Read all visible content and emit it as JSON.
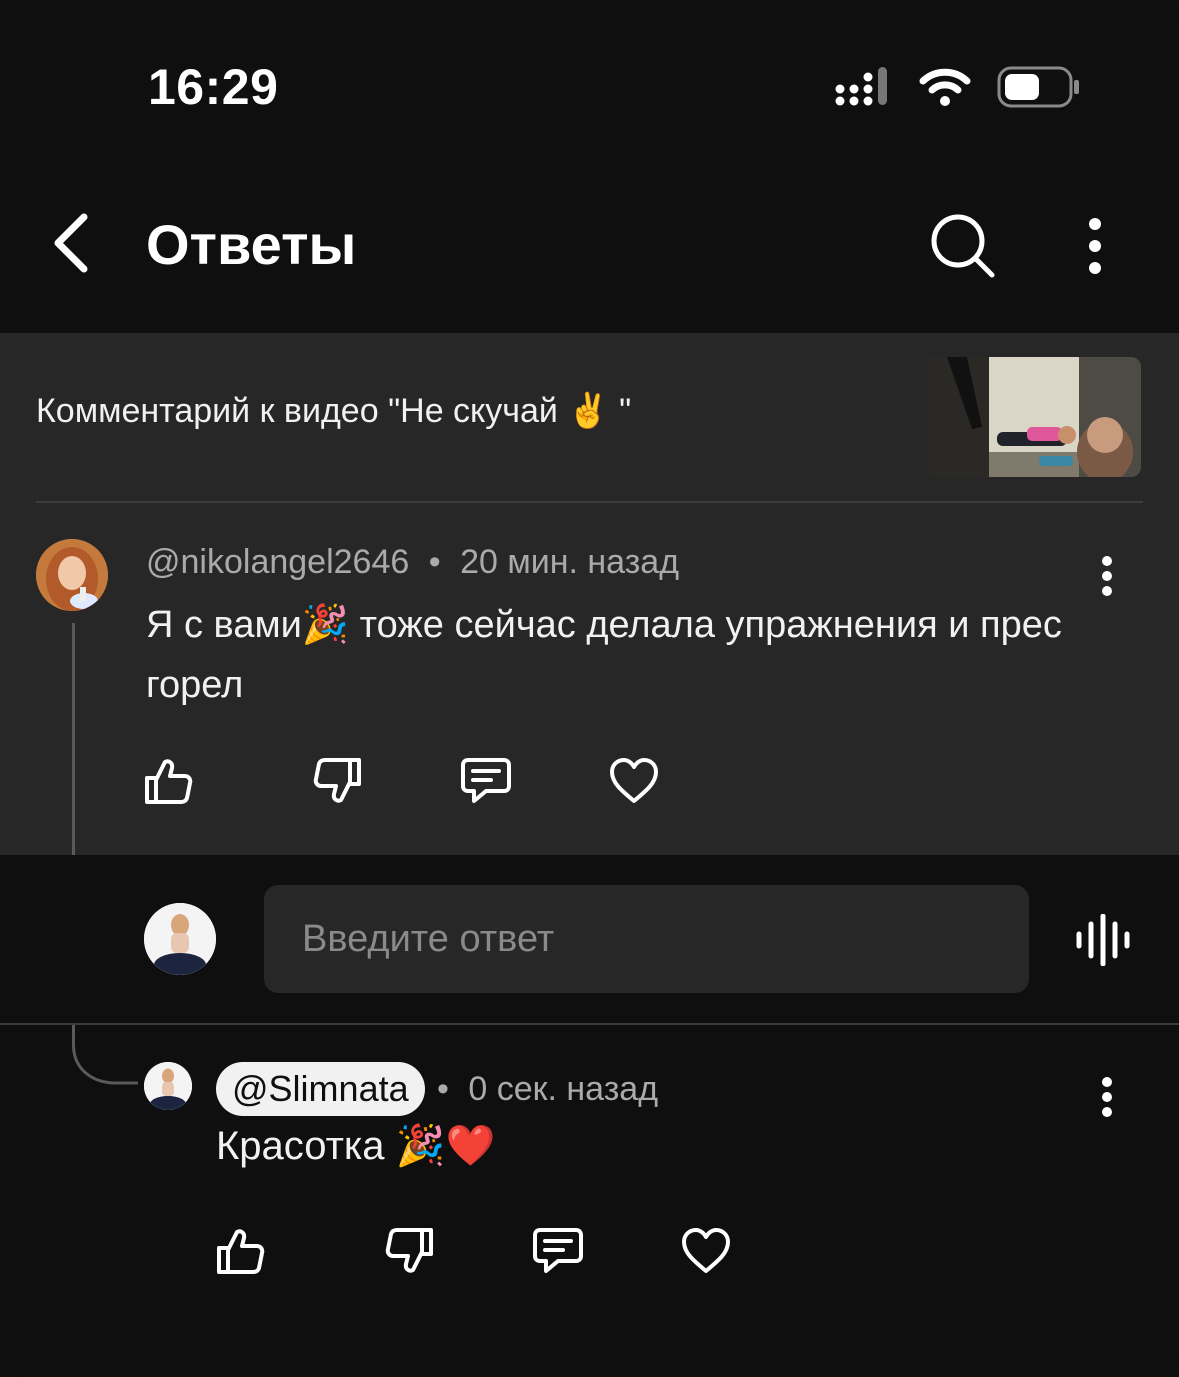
{
  "status_bar": {
    "time": "16:29",
    "icons": [
      "signal-icon",
      "wifi-icon",
      "battery-icon"
    ]
  },
  "header": {
    "title": "Ответы",
    "icons": [
      "back-arrow-icon",
      "search-icon",
      "more-vert-icon"
    ]
  },
  "video": {
    "caption": "Комментарий к видео \"Не скучай ✌️ \""
  },
  "parent_comment": {
    "author": "@nikolangel2646",
    "separator": "•",
    "time": "20 мин. назад",
    "text": "Я с вами🎉 тоже сейчас делала упражнения и прес горел",
    "actions": [
      "like-icon",
      "dislike-icon",
      "reply-icon",
      "heart-icon"
    ]
  },
  "reply_box": {
    "placeholder": "Введите ответ",
    "voice_icon": "voice-search-icon"
  },
  "reply_comment": {
    "author": "@Slimnata",
    "separator": "•",
    "time": "0 сек. назад",
    "text": "Красотка 🎉❤️",
    "actions": [
      "like-icon",
      "dislike-icon",
      "reply-icon",
      "heart-icon"
    ]
  },
  "colors": {
    "background": "#0f0f0f",
    "panel": "#272727",
    "text": "#f1f1f1",
    "secondary_text": "#aaaaaa"
  }
}
